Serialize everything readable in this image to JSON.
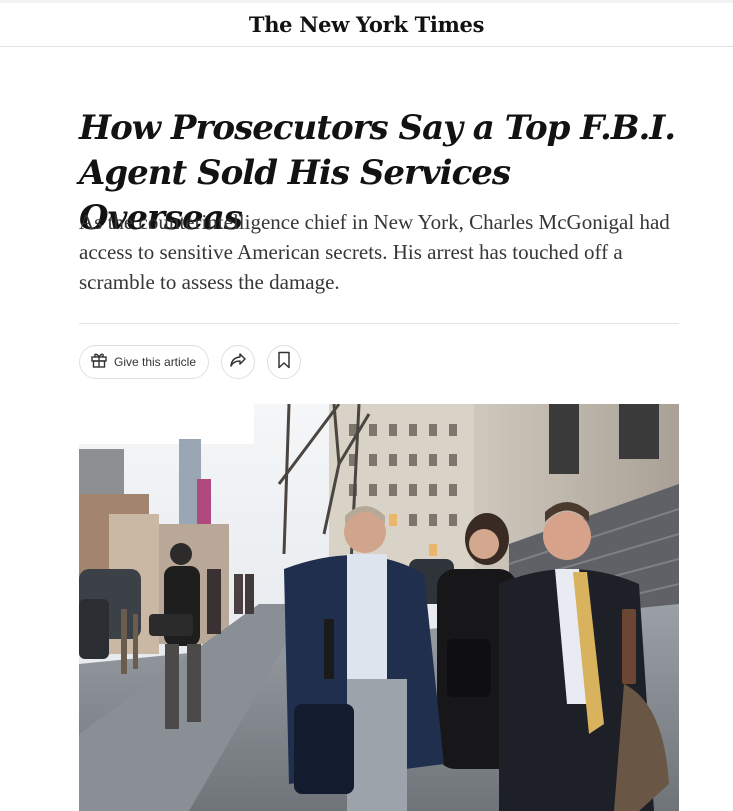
{
  "masthead": {
    "logo_text": "The New York Times"
  },
  "article": {
    "headline_line1": "How Prosecutors Say a Top F.B.I.",
    "headline_line2": "Agent Sold His Services Overseas",
    "summary": "As the counterintelligence chief in New York, Charles McGonigal had access to sensitive American secrets. His arrest has touched off a scramble to assess the damage."
  },
  "actions": {
    "give_label": "Give this article",
    "icons": [
      "gift-icon",
      "share-icon",
      "bookmark-icon"
    ]
  },
  "colors": {
    "text": "#121212",
    "summary": "#363636",
    "rule": "#e2e2e2"
  }
}
